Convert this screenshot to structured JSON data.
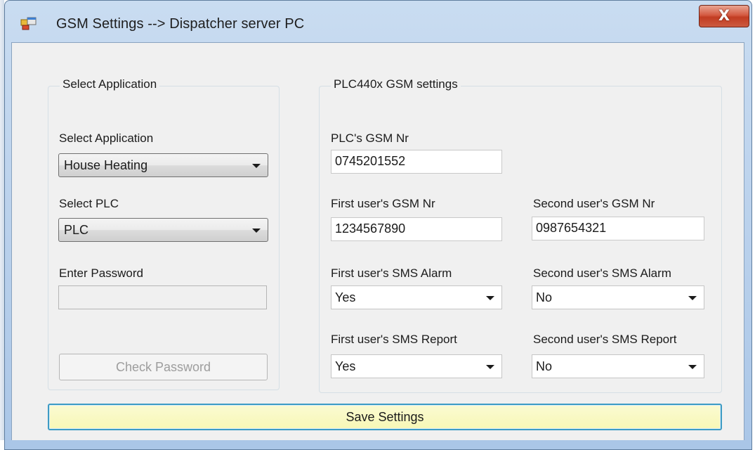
{
  "window": {
    "title": "GSM Settings --> Dispatcher server PC",
    "close_label": "X"
  },
  "app_group": {
    "title": "Select Application",
    "application_label": "Select Application",
    "application_value": "House Heating",
    "plc_label": "Select PLC",
    "plc_value": "PLC",
    "password_label": "Enter Password",
    "password_value": "",
    "check_password_label": "Check Password"
  },
  "gsm_group": {
    "title": "PLC440x  GSM settings",
    "plc_gsm_label": "PLC's GSM Nr",
    "plc_gsm_value": "0745201552",
    "first_gsm_label": "First user's GSM Nr",
    "first_gsm_value": "1234567890",
    "second_gsm_label": "Second user's GSM Nr",
    "second_gsm_value": "0987654321",
    "first_alarm_label": "First user's SMS Alarm",
    "first_alarm_value": "Yes",
    "second_alarm_label": "Second user's SMS Alarm",
    "second_alarm_value": "No",
    "first_report_label": "First user's SMS Report",
    "first_report_value": "Yes",
    "second_report_label": "Second user's SMS Report",
    "second_report_value": "No"
  },
  "footer": {
    "save_label": "Save Settings"
  },
  "icons": {
    "app_icon": "window-app-icon",
    "close_icon": "close-icon",
    "dropdown_icon": "chevron-down-icon"
  },
  "colors": {
    "save_button_bg": "#f7f7b6",
    "save_button_border": "#3d9bc4",
    "close_button": "#c13c22"
  }
}
